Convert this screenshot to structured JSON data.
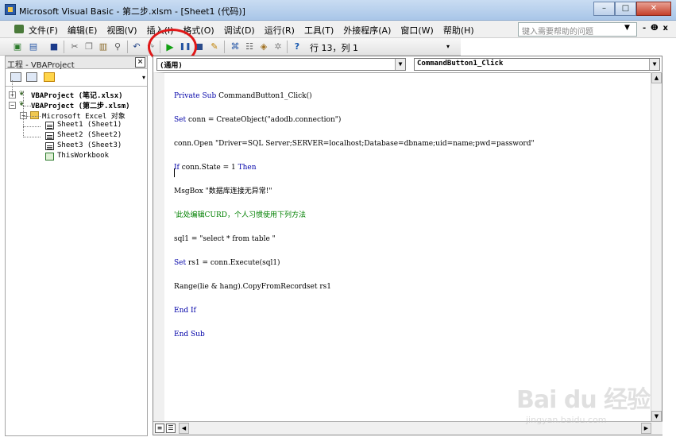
{
  "window": {
    "title": "Microsoft Visual Basic - 第二步.xlsm - [Sheet1 (代码)]",
    "minimize": "–",
    "maximize": "□",
    "close": "✕"
  },
  "menu": {
    "items": [
      "文件(F)",
      "编辑(E)",
      "视图(V)",
      "插入(I)",
      "格式(O)",
      "调试(D)",
      "运行(R)",
      "工具(T)",
      "外接程序(A)",
      "窗口(W)",
      "帮助(H)"
    ],
    "help_placeholder": "键入需要帮助的问题",
    "mdi_min": "-",
    "mdi_restore": "ⴲ",
    "mdi_close": "x"
  },
  "toolbar": {
    "run_icon": "run-icon",
    "cursor_position": "行 13，列 1"
  },
  "project": {
    "title": "工程 - VBAProject",
    "close_label": "×",
    "tree": [
      {
        "label": "VBAProject (笔记.xlsx)",
        "expander": "+",
        "bold": true
      },
      {
        "label": "VBAProject (第二步.xlsm)",
        "expander": "−",
        "bold": true
      },
      {
        "label": "Microsoft Excel 对象",
        "expander": "−",
        "bold": false
      },
      {
        "label": "Sheet1 (Sheet1)",
        "bold": false
      },
      {
        "label": "Sheet2 (Sheet2)",
        "bold": false
      },
      {
        "label": "Sheet3 (Sheet3)",
        "bold": false
      },
      {
        "label": "ThisWorkbook",
        "bold": false
      }
    ]
  },
  "code_window": {
    "object_combo": "(通用)",
    "procedure_combo": "CommandButton1_Click",
    "lines": [
      "Private Sub CommandButton1_Click()",
      "Set conn = CreateObject(\"adodb.connection\")",
      "conn.Open \"Driver=SQL Server;SERVER=localhost;Database=dbname;uid=name;pwd=password\"",
      "If conn.State = 1 Then",
      "MsgBox \"数据库连接无异常!\"",
      "'此处编辑CURD，个人习惯使用下列方法",
      "sql1 = \"select * from table \"",
      "Set rs1 = conn.Execute(sql1)",
      "Range(lie & hang).CopyFromRecordset rs1",
      "End If",
      "End Sub"
    ]
  },
  "watermark": {
    "logo": "Bai du 经验",
    "url": "jingyan.baidu.com"
  },
  "colors": {
    "keyword": "#0000a8",
    "comment": "#008000",
    "highlight_ring": "#e01818"
  }
}
